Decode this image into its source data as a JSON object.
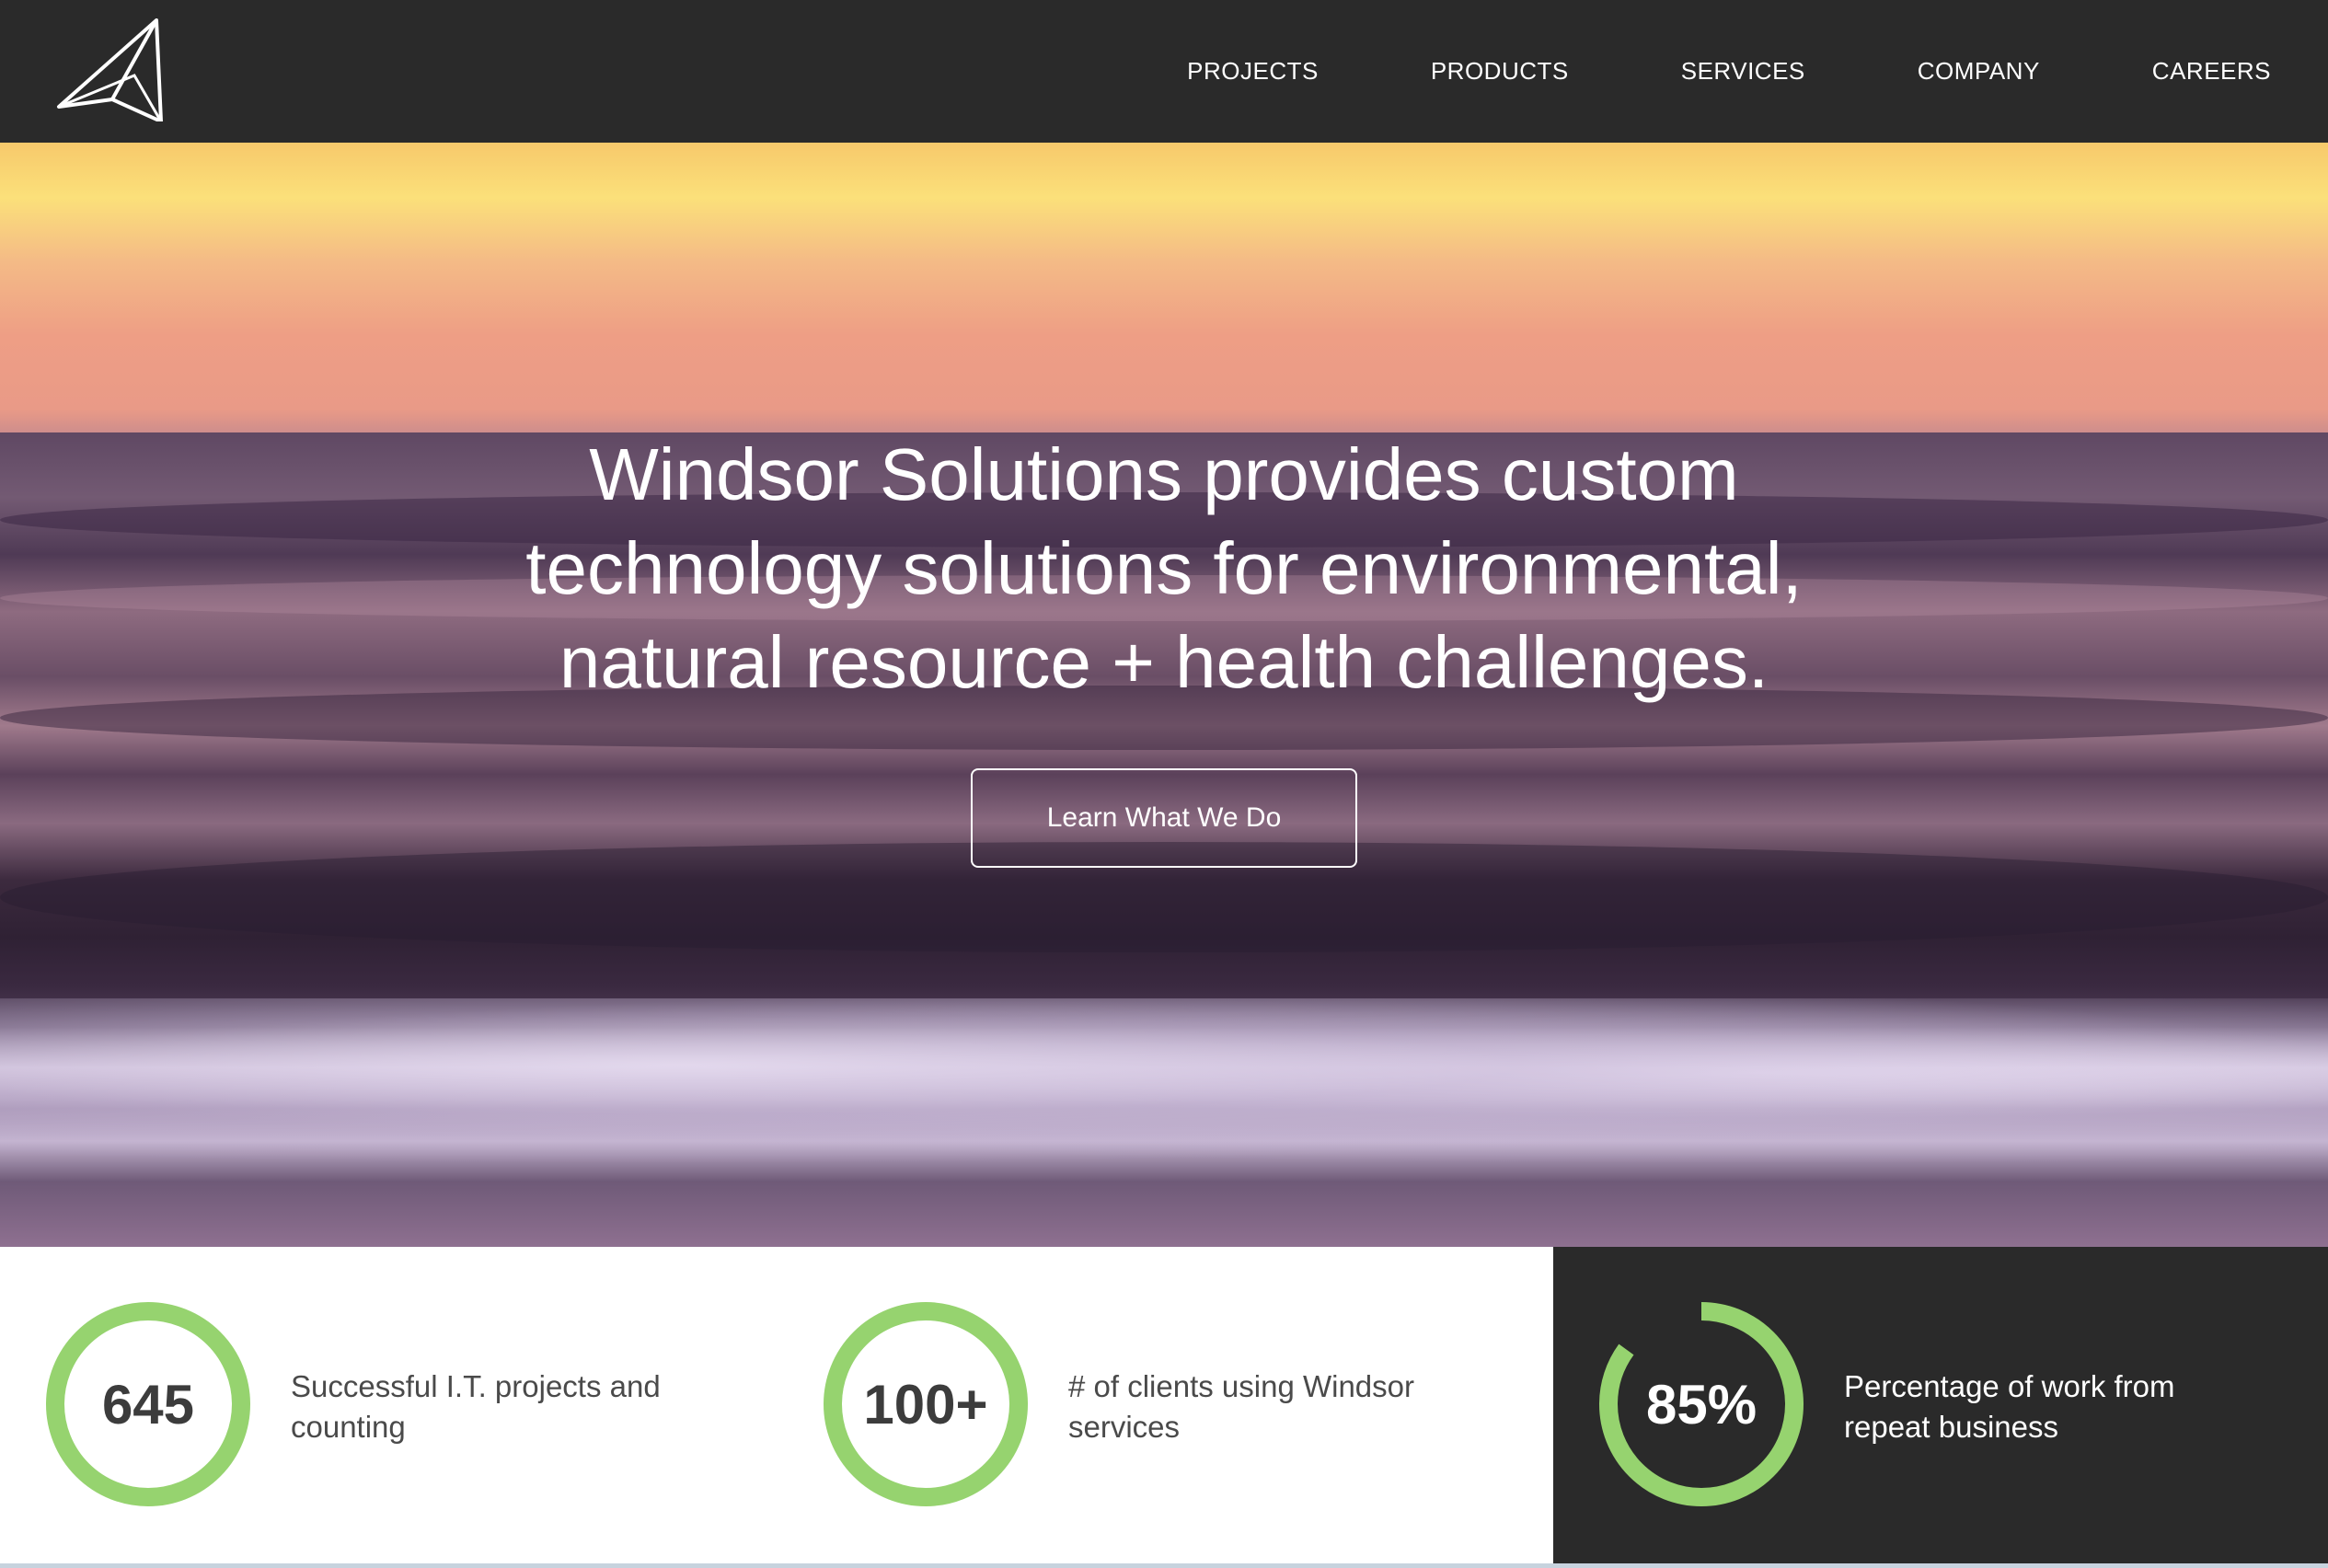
{
  "header": {
    "logo_icon": "paper-plane-triangle-logo",
    "nav": [
      "PROJECTS",
      "PRODUCTS",
      "SERVICES",
      "COMPANY",
      "CAREERS"
    ]
  },
  "hero": {
    "headline_lines": [
      "Windsor Solutions provides custom",
      "technology solutions for environmental,",
      "natural resource + health challenges."
    ],
    "cta_label": "Learn What We Do"
  },
  "stats": [
    {
      "value": "645",
      "description": "Successful I.T. projects and counting",
      "progress": 1.0
    },
    {
      "value": "100+",
      "description": "# of clients using Windsor services",
      "progress": 1.0
    },
    {
      "value": "85%",
      "description": "Percentage of work from repeat business",
      "progress": 0.85
    }
  ],
  "colors": {
    "header_bg": "#2a2a2a",
    "ring_green": "#96d36f",
    "text_dark": "#3c3c3c"
  }
}
